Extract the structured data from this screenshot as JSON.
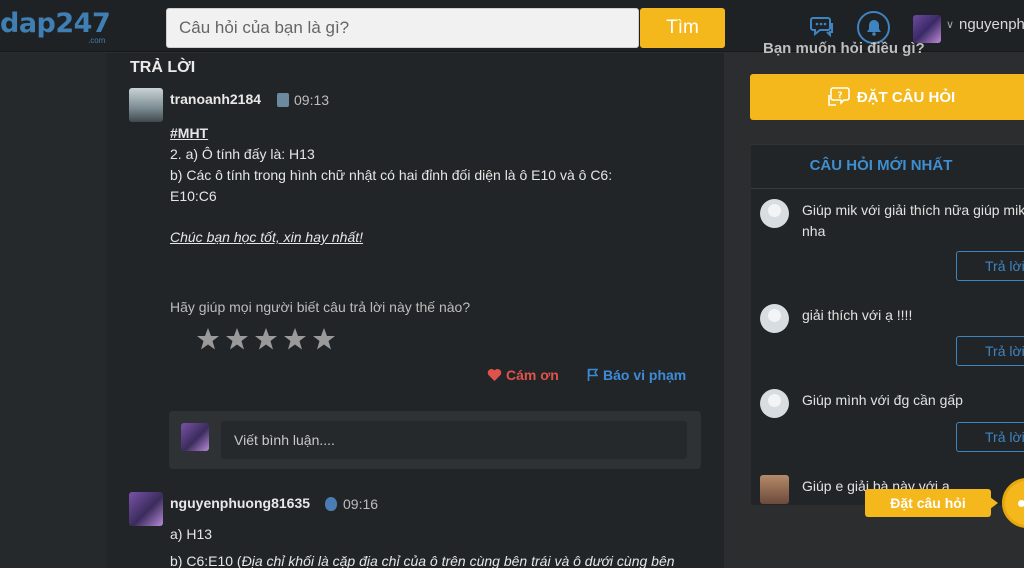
{
  "header": {
    "logo": "dap247",
    "logo_sub": ".com",
    "search_placeholder": "Câu hỏi của bạn là gì?",
    "search_button": "Tìm",
    "username": "nguyenph"
  },
  "main": {
    "section_title": "TRẢ LỜI",
    "answer1": {
      "user": "tranoanh2184",
      "time": "09:13",
      "hashtag": "#MHT",
      "line1": "2. a) Ô tính đấy là: H13",
      "line2": "b) Các ô tính trong hình chữ nhật có hai đỉnh đối diện là ô E10 và ô C6:",
      "line3": "E10:C6",
      "thanks": "Chúc bạn học tốt, xin hay nhất!",
      "ask_help": "Hãy giúp mọi người biết câu trả lời này thế nào?",
      "stars": 5,
      "thank_label": "Cám ơn",
      "report_label": "Báo vi phạm",
      "comment_placeholder": "Viết bình luận...."
    },
    "answer2": {
      "user": "nguyenphuong81635",
      "time": "09:16",
      "line1": "a) H13",
      "line2_prefix": "b) C6:E10 (",
      "line2_italic": "Địa chỉ khối là cặp địa chỉ của ô trên cùng bên trái và ô dưới cùng bên"
    }
  },
  "sidebar": {
    "cut_text": "Bạn muốn hỏi điều gì?",
    "ask_button": "ĐẶT CÂU HỎI",
    "new_questions_title": "CÂU HỎI MỚI NHẤT",
    "reply_label": "Trả lời",
    "questions": [
      {
        "text": "Giúp mik với giải thích nữa giúp mik nha"
      },
      {
        "text": "giải thích với ạ !!!!"
      },
      {
        "text": "Giúp mình với đg cần gấp"
      },
      {
        "text": "Giúp e giải bà này với a"
      }
    ],
    "float_label": "Đặt câu hỏi"
  },
  "colors": {
    "accent": "#f4b81c",
    "link": "#3e8ed0",
    "heart": "#e0524c"
  }
}
